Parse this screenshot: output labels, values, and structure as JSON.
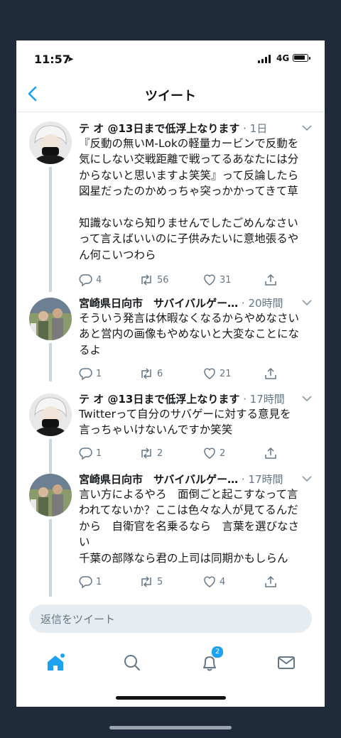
{
  "status_bar": {
    "time": "11:57",
    "network": "4G"
  },
  "nav": {
    "title": "ツイート"
  },
  "tweets": [
    {
      "name": "テ オ @13日まで低浮上なります",
      "handle": "",
      "time": "1日",
      "text": "『反動の無いM-Lokの軽量カービンで反動を\n気にしない交戦距離で戦ってるあなたには分\nからないと思いますよ笑笑』って反論したら\n図星だったのかめっちゃ突っかかってきて草\n\n知識ないなら知りませんでしたごめんなさい\nって言えばいいのに子供みたいに意地張るや\nん何こいつわら",
      "replies": "4",
      "retweets": "56",
      "likes": "31"
    },
    {
      "name": "宮崎県日向市　サバイバルゲー…",
      "handle": "",
      "time": "20時間",
      "text": "そういう発言は休暇なくなるからやめなさい\nあと営内の画像もやめないと大変なことにな\nるよ",
      "replies": "1",
      "retweets": "6",
      "likes": "21"
    },
    {
      "name": "テ オ @13日まで低浮上なります",
      "handle": "",
      "time": "17時間",
      "text": "Twitterって自分のサバゲーに対する意見を\n言っちゃいけないんですか笑笑",
      "replies": "1",
      "retweets": "2",
      "likes": "2"
    },
    {
      "name": "宮崎県日向市　サバイバルゲー…",
      "handle": "",
      "time": "17時間",
      "text": "言い方によるやろ　面倒ごと起こすなって言\nわれてないか？ここは色々な人が見てるんだ\nから　自衛官を名乗るなら　言葉を選びなさ\nい\n千葉の部隊なら君の上司は同期かもしらん",
      "replies": "1",
      "retweets": "5",
      "likes": "4"
    }
  ],
  "reply_box": {
    "placeholder": "返信をツイート"
  },
  "tabbar": {
    "notification_count": "2"
  },
  "colors": {
    "accent": "#1da1f2",
    "text": "#14171a",
    "muted": "#657786",
    "frame": "#1f2b3a"
  }
}
